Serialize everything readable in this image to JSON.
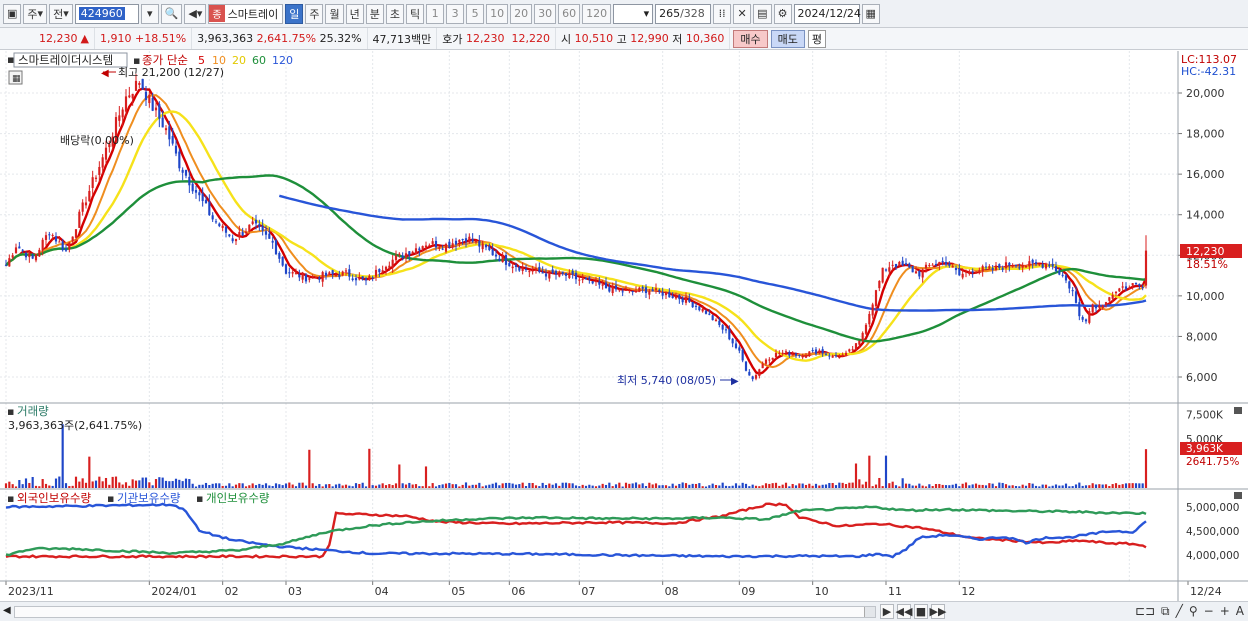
{
  "toolbar": {
    "market_label": "주",
    "type_label": "전",
    "code": "424960",
    "stock_tag": "종",
    "stock_name": "스마트레이",
    "periods": [
      "일",
      "주",
      "월",
      "년",
      "분",
      "초",
      "틱"
    ],
    "active_period": "일",
    "intervals": [
      "1",
      "3",
      "5",
      "10",
      "20",
      "30",
      "60",
      "120"
    ],
    "count": "265",
    "count_total": "/328",
    "date": "2024/12/24"
  },
  "info": {
    "price": "12,230",
    "change": "1,910",
    "change_pct": "+18.51%",
    "volume": "3,963,363",
    "volume_ratio": "2,641.75%",
    "turnover": "25.32%",
    "amount": "47,713백만",
    "bid_label": "호가",
    "bid1": "12,230",
    "bid2": "12,220",
    "open_label": "시",
    "open": "10,510",
    "high_label": "고",
    "high": "12,990",
    "low_label": "저",
    "low": "10,360",
    "buy_label": "매수",
    "sell_label": "매도",
    "avg_label": "평"
  },
  "price_panel": {
    "title": "스마트레이더시스템",
    "legend_title": "종가 단순",
    "ma_labels": [
      "5",
      "10",
      "20",
      "60",
      "120"
    ],
    "ma_colors": [
      "#d40000",
      "#ef8e1f",
      "#f6e21a",
      "#1e8f3a",
      "#2855d8"
    ],
    "lc_label": "LC:113.07",
    "hc_label": "HC:-42.31",
    "y_ticks": [
      "20,000",
      "18,000",
      "16,000",
      "14,000",
      "12,000",
      "10,000",
      "8,000",
      "6,000"
    ],
    "high_marker": "최고 21,200 (12/27)",
    "low_marker": "최저 5,740 (08/05)",
    "dividend_marker": "배당락(0.00%)",
    "current_price_tag": "12,230",
    "current_change_tag": "18.51%"
  },
  "volume_panel": {
    "title": "거래량",
    "value_line": "3,963,363주(2,641.75%)",
    "y_ticks": [
      "7,500K",
      "5,000K"
    ],
    "current_tag": "3,963K",
    "current_pct": "2641.75%"
  },
  "holdings_panel": {
    "series": [
      "외국인보유수량",
      "기관보유수량",
      "개인보유수량"
    ],
    "y_ticks": [
      "5,000,000",
      "4,500,000",
      "4,000,000"
    ]
  },
  "x_axis": {
    "labels": [
      "2023/11",
      "2024/01",
      "02",
      "03",
      "04",
      "05",
      "06",
      "07",
      "08",
      "09",
      "10",
      "11",
      "12",
      "12/24"
    ]
  },
  "chart_data": {
    "type": "candlestick",
    "price_anchors": [
      [
        0,
        11500
      ],
      [
        3,
        12500
      ],
      [
        8,
        11800
      ],
      [
        13,
        13200
      ],
      [
        18,
        12200
      ],
      [
        24,
        14800
      ],
      [
        30,
        17200
      ],
      [
        36,
        19800
      ],
      [
        40,
        20600
      ],
      [
        44,
        19300
      ],
      [
        48,
        18200
      ],
      [
        52,
        16500
      ],
      [
        56,
        15400
      ],
      [
        62,
        13800
      ],
      [
        68,
        12800
      ],
      [
        74,
        13500
      ],
      [
        80,
        12600
      ],
      [
        84,
        11200
      ],
      [
        90,
        10900
      ],
      [
        96,
        11000
      ],
      [
        102,
        11100
      ],
      [
        108,
        10700
      ],
      [
        114,
        11600
      ],
      [
        120,
        12100
      ],
      [
        126,
        12600
      ],
      [
        132,
        12500
      ],
      [
        138,
        12900
      ],
      [
        144,
        12300
      ],
      [
        150,
        11700
      ],
      [
        156,
        11300
      ],
      [
        162,
        11100
      ],
      [
        168,
        11000
      ],
      [
        174,
        10700
      ],
      [
        180,
        10400
      ],
      [
        186,
        10200
      ],
      [
        192,
        10300
      ],
      [
        198,
        10100
      ],
      [
        204,
        9800
      ],
      [
        210,
        9200
      ],
      [
        216,
        8200
      ],
      [
        220,
        7200
      ],
      [
        222,
        6400
      ],
      [
        224,
        5900
      ],
      [
        228,
        6900
      ],
      [
        232,
        7200
      ],
      [
        238,
        7100
      ],
      [
        244,
        7300
      ],
      [
        248,
        7000
      ],
      [
        252,
        7100
      ],
      [
        256,
        7700
      ],
      [
        260,
        9700
      ],
      [
        263,
        11200
      ],
      [
        266,
        11600
      ],
      [
        270,
        11400
      ],
      [
        274,
        11100
      ],
      [
        278,
        11600
      ],
      [
        282,
        11700
      ],
      [
        286,
        11000
      ],
      [
        290,
        11300
      ],
      [
        296,
        11300
      ],
      [
        302,
        11600
      ],
      [
        308,
        11500
      ],
      [
        313,
        11600
      ],
      [
        317,
        11000
      ],
      [
        320,
        10200
      ],
      [
        322,
        9000
      ],
      [
        324,
        8900
      ],
      [
        326,
        9600
      ],
      [
        328,
        9500
      ],
      [
        331,
        10000
      ],
      [
        334,
        10200
      ],
      [
        337,
        10600
      ],
      [
        339,
        10400
      ],
      [
        341,
        10320
      ],
      [
        342,
        12230
      ]
    ],
    "volume_spikes": [
      [
        17,
        6500
      ],
      [
        25,
        3200
      ],
      [
        91,
        3900
      ],
      [
        109,
        4000
      ],
      [
        118,
        2400
      ],
      [
        126,
        2200
      ],
      [
        255,
        2500
      ],
      [
        259,
        3300
      ],
      [
        264,
        3300
      ],
      [
        342,
        3963
      ]
    ],
    "foreign_holdings": [
      [
        0,
        3970000
      ],
      [
        95,
        3970000
      ],
      [
        97,
        4230000
      ],
      [
        99,
        4860000
      ],
      [
        110,
        4840000
      ],
      [
        120,
        4810000
      ],
      [
        130,
        4690000
      ],
      [
        150,
        4650000
      ],
      [
        180,
        4680000
      ],
      [
        200,
        4660000
      ],
      [
        214,
        4800000
      ],
      [
        228,
        5050000
      ],
      [
        234,
        5060000
      ],
      [
        238,
        4780000
      ],
      [
        250,
        4600000
      ],
      [
        262,
        4650000
      ],
      [
        275,
        4560000
      ],
      [
        290,
        4350000
      ],
      [
        300,
        4310000
      ],
      [
        312,
        4250000
      ],
      [
        322,
        4300000
      ],
      [
        330,
        4250000
      ],
      [
        338,
        4230000
      ],
      [
        342,
        4180000
      ]
    ],
    "institution_holdings": [
      [
        0,
        5000000
      ],
      [
        50,
        5050000
      ],
      [
        54,
        4920000
      ],
      [
        58,
        4500000
      ],
      [
        68,
        4310000
      ],
      [
        80,
        4190000
      ],
      [
        96,
        4100000
      ],
      [
        110,
        4030000
      ],
      [
        130,
        4030000
      ],
      [
        160,
        4020000
      ],
      [
        190,
        3990000
      ],
      [
        205,
        3980000
      ],
      [
        215,
        3970000
      ],
      [
        240,
        3980000
      ],
      [
        255,
        3970000
      ],
      [
        262,
        4020000
      ],
      [
        266,
        3970000
      ],
      [
        270,
        4120000
      ],
      [
        274,
        4360000
      ],
      [
        282,
        4420000
      ],
      [
        292,
        4330000
      ],
      [
        300,
        4380000
      ],
      [
        306,
        4260000
      ],
      [
        312,
        4370000
      ],
      [
        318,
        4360000
      ],
      [
        332,
        4500000
      ],
      [
        338,
        4480000
      ],
      [
        342,
        4700000
      ]
    ],
    "individual_holdings": [
      [
        0,
        4000000
      ],
      [
        8,
        4130000
      ],
      [
        20,
        4130000
      ],
      [
        36,
        4080000
      ],
      [
        50,
        4040000
      ],
      [
        70,
        4100000
      ],
      [
        84,
        4250000
      ],
      [
        96,
        4480000
      ],
      [
        108,
        4600000
      ],
      [
        120,
        4680000
      ],
      [
        140,
        4750000
      ],
      [
        160,
        4780000
      ],
      [
        180,
        4760000
      ],
      [
        200,
        4760000
      ],
      [
        214,
        4780000
      ],
      [
        228,
        4740000
      ],
      [
        238,
        4920000
      ],
      [
        250,
        4960000
      ],
      [
        260,
        5000000
      ],
      [
        270,
        4930000
      ],
      [
        282,
        4950000
      ],
      [
        300,
        4920000
      ],
      [
        320,
        4900000
      ],
      [
        330,
        4880000
      ],
      [
        342,
        4870000
      ]
    ]
  }
}
